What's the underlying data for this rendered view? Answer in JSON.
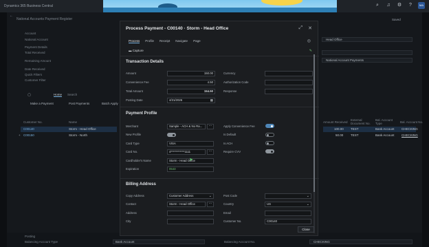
{
  "topbar": {
    "app_name": "Dynamics 365 Business Central",
    "saved": "Saved",
    "user_initials": "MA"
  },
  "bg": {
    "page_title": "National Accounts Payment Register",
    "account": "Account",
    "national_account": "National Account",
    "payment_details": "Payment Details",
    "total_received": "Total Received",
    "remaining_amount": "Remaining Amount",
    "date_received": "Date Received",
    "quick_filters": "Quick Filters",
    "customer_filter": "Customer Filter",
    "tab_home": "Home",
    "tab_search": "Search",
    "make_payment": "Make a Payment",
    "post_payments": "Post Payments",
    "batch_apply": "Batch Apply",
    "col_customer_no": "Customer No.",
    "col_name": "Name",
    "col_amount_received": "Amount Received",
    "col_external_doc": "External Document No.",
    "col_bal_account_type": "Bal. Account Type",
    "col_bal_account_no": "Bal. Account No.",
    "rows": [
      {
        "no": "C00140",
        "name": "Storm - Head Office",
        "amount": "100.00",
        "ext": "TEST",
        "type": "Bank Account",
        "acct": "CHECKING"
      },
      {
        "no": "C00150",
        "name": "Storm - North",
        "amount": "50.00",
        "ext": "TEST",
        "type": "Bank Account",
        "acct": "CHECKING"
      }
    ],
    "right_head_office": "Head Office",
    "right_national": "National Account Payments",
    "footer_posting": "Posting",
    "footer_bal_type_label": "Balancing Account Type",
    "footer_bal_type_value": "Bank Account",
    "footer_bal_no_label": "Balancing Account No.",
    "footer_bal_no_value": "CHECKING"
  },
  "dialog": {
    "title": "Process Payment - C00140 · Storm - Head Office",
    "tabs": [
      "Process",
      "Profile",
      "Receipt",
      "Navigate",
      "Page"
    ],
    "capture": "Capture",
    "transaction_details": "Transaction Details",
    "amount_label": "Amount",
    "amount": "150.00",
    "conv_fee_label": "Convenience Fee",
    "conv_fee": "4.50",
    "total_label": "Total Amount",
    "total": "154.50",
    "posting_date_label": "Posting Date",
    "posting_date": "4/21/2026",
    "currency_label": "Currency",
    "auth_code_label": "Authorization Code",
    "response_label": "Response",
    "payment_profile": "Payment Profile",
    "merchant_label": "Merchant",
    "merchant": "Sample - ACH & No Ra...",
    "new_profile_label": "New Profile",
    "card_type_label": "Card Type",
    "card_type": "VISA",
    "card_no_label": "Card No.",
    "card_no": "4************1111",
    "cardholder_label": "Cardholder's Name",
    "cardholder": "Storm - Head Office",
    "expiration_label": "Expiration",
    "expiration": "0543",
    "apply_fee_label": "Apply Convenience Fee",
    "is_default_label": "Is Default",
    "is_ach_label": "Is ACH",
    "require_cvv_label": "Require CVV",
    "billing_address": "Billing Address",
    "copy_address_label": "Copy Address",
    "copy_address": "Customer Address",
    "contact_label": "Contact",
    "contact": "Storm - Head Office",
    "address_label": "Address",
    "city_label": "City",
    "post_code_label": "Post Code",
    "country_label": "Country",
    "country": "US",
    "email_label": "Email",
    "customer_no_label": "Customer No.",
    "customer_no": "C00140",
    "close": "Close"
  },
  "colors": {
    "accent": "#4f86b7",
    "dialog_bg": "#1b1d20",
    "page_bg": "#15181c"
  }
}
